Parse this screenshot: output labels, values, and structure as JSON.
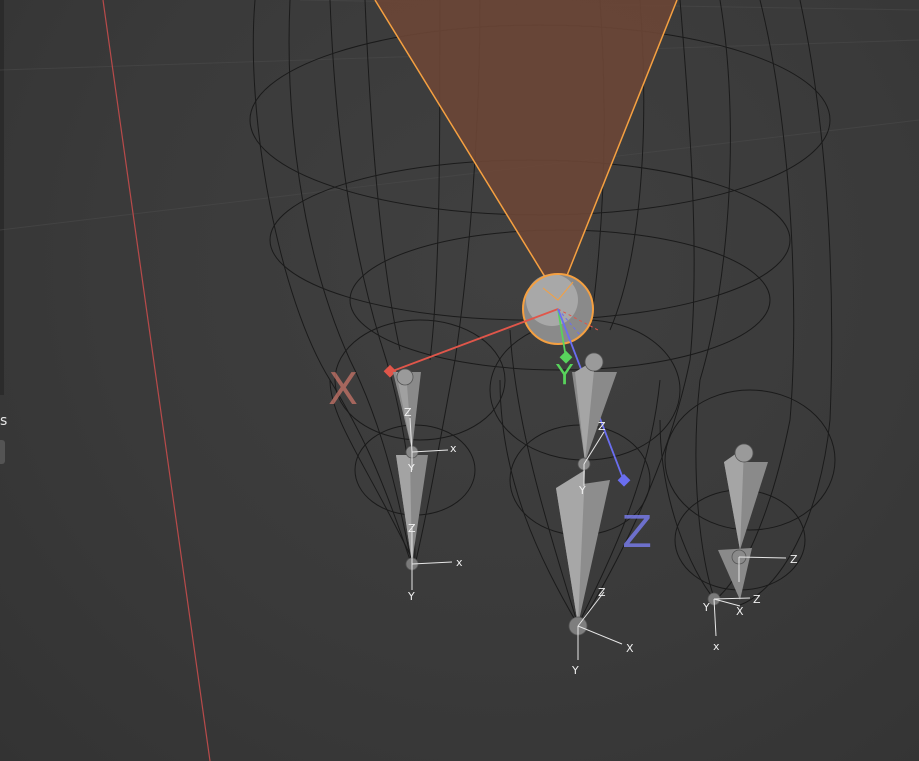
{
  "viewport": {
    "background": "#3a3a3a",
    "axis_color_x": "#b84a4a",
    "selection_color": "#f5a041",
    "light_cone_fill": "#6b4636"
  },
  "left_panel": {
    "label_fragment": "s"
  },
  "gizmo": {
    "x_label": "X",
    "y_label": "Y",
    "z_label": "Z",
    "x_color": "#e0564a",
    "y_color": "#58d35c",
    "z_color": "#6a6ef0"
  },
  "bones": {
    "axis_x": "x",
    "axis_y": "Y",
    "axis_z": "Z",
    "axis_X": "X",
    "axis_y_lower": "Y",
    "axis_z_lower": "Z"
  }
}
